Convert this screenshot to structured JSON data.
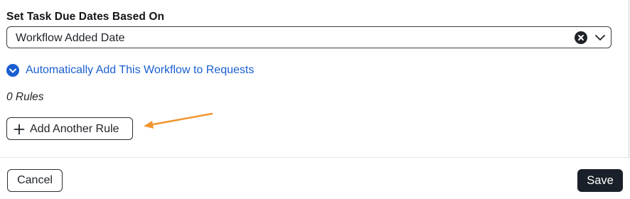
{
  "form": {
    "due_dates_label": "Set Task Due Dates Based On",
    "due_dates_select": {
      "value": "Workflow Added Date",
      "clear_icon": "x-circle-icon",
      "dropdown_icon": "chevron-down-icon"
    },
    "auto_add": {
      "label": "Automatically Add This Workflow to Requests",
      "icon": "chevron-down-circle-icon",
      "color": "#1a5fd0"
    },
    "rules_count": "0 Rules",
    "add_rule_button": {
      "label": "Add Another Rule",
      "icon": "plus-icon"
    },
    "annotation_arrow_color": "#f0962f"
  },
  "footer": {
    "cancel_label": "Cancel",
    "save_label": "Save",
    "save_color": "#1a2029"
  }
}
